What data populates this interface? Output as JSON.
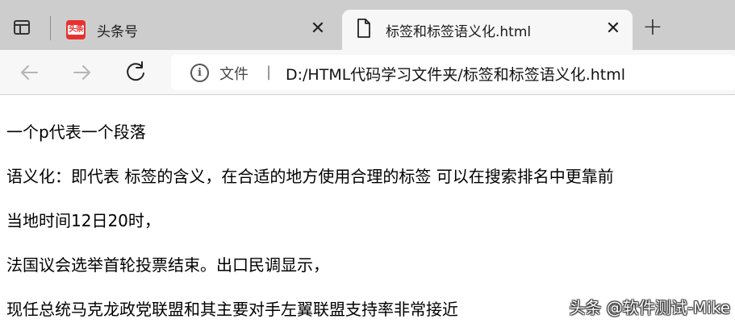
{
  "tabs": [
    {
      "title": "头条号",
      "favicon_text": "头条",
      "active": false
    },
    {
      "title": "标签和标签语义化.html",
      "active": true
    }
  ],
  "address_bar": {
    "scheme_label": "文件",
    "divider": "|",
    "url": "D:/HTML代码学习文件夹/标签和标签语义化.html"
  },
  "page": {
    "paragraphs": [
      "一个p代表一个段落",
      "语义化：即代表 标签的含义，在合适的地方使用合理的标签 可以在搜索排名中更靠前",
      "当地时间12日20时，",
      "法国议会选举首轮投票结束。出口民调显示，",
      "现任总统马克龙政党联盟和其主要对手左翼联盟支持率非常接近"
    ],
    "watermark": "头条 @软件测试-Mike"
  },
  "colors": {
    "tabstrip_bg": "#cdcdcd",
    "toolbar_bg": "#f7f7f7",
    "favicon_red": "#e8312f"
  },
  "icons": [
    "tab-actions-icon",
    "toutiao-favicon",
    "close-icon",
    "file-icon",
    "plus-icon",
    "back-arrow-icon",
    "forward-arrow-icon",
    "reload-icon",
    "info-icon"
  ]
}
